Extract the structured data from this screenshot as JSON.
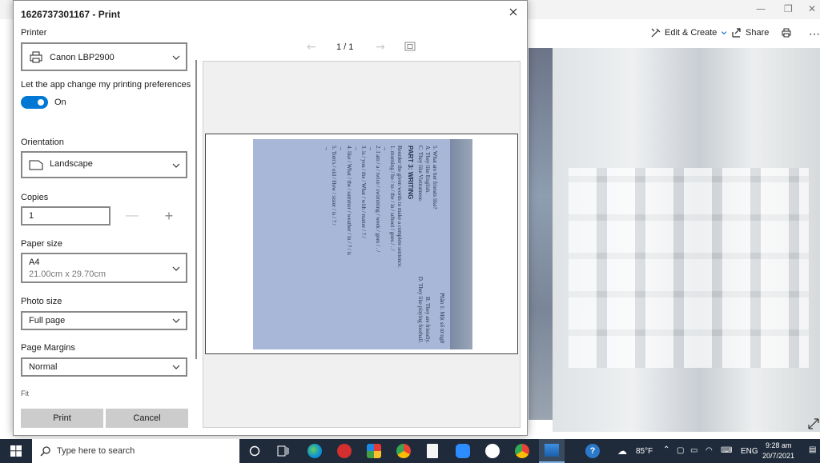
{
  "photos": {
    "edit_create_label": "Edit & Create",
    "share_label": "Share"
  },
  "dialog": {
    "title": "1626737301167 - Print",
    "printer_label": "Printer",
    "printer_value": "Canon LBP2900",
    "pref_label": "Let the app change my printing preferences",
    "pref_state": "On",
    "orientation_label": "Orientation",
    "orientation_value": "Landscape",
    "copies_label": "Copies",
    "copies_value": "1",
    "paper_label": "Paper size",
    "paper_value": "A4",
    "paper_dims": "21.00cm x 29.70cm",
    "photo_size_label": "Photo size",
    "photo_size_value": "Full page",
    "margins_label": "Page Margins",
    "margins_value": "Normal",
    "more_label": "Fit",
    "print_label": "Print",
    "cancel_label": "Cancel",
    "page_counter": "1 / 1"
  },
  "scan": {
    "header": "Phần 1: Một số từ ngữ",
    "q5": "5. What are her friends like?",
    "q5a": "A. They like English.",
    "q5b": "B. They are friendly.",
    "q5c": "C. They like Vietnamese.",
    "q5d": "D. They like playing football.",
    "part": "PART 3: WRITING",
    "instr": "Reorder the given words to make a complete sentence.",
    "s1": "1. morning / he / to / the / in / school / goes / . /",
    "s2": "2. I am / a / twice / swimming / week / goes / . /",
    "s3": "3. is / you / the / What / with / matter / ? /",
    "s4": "4. like / What / the / summer / weather / in / ? / is",
    "s5": "5. Tom's / old / How / sister / is / ? /",
    "arrow": "→"
  },
  "taskbar": {
    "search_placeholder": "Type here to search",
    "weather": "85°F",
    "language": "ENG",
    "time": "9:28 am",
    "date": "20/7/2021"
  },
  "colors": {
    "accent": "#0078d4",
    "taskbar": "#1f2b3a",
    "button_bg": "#cccccc"
  }
}
